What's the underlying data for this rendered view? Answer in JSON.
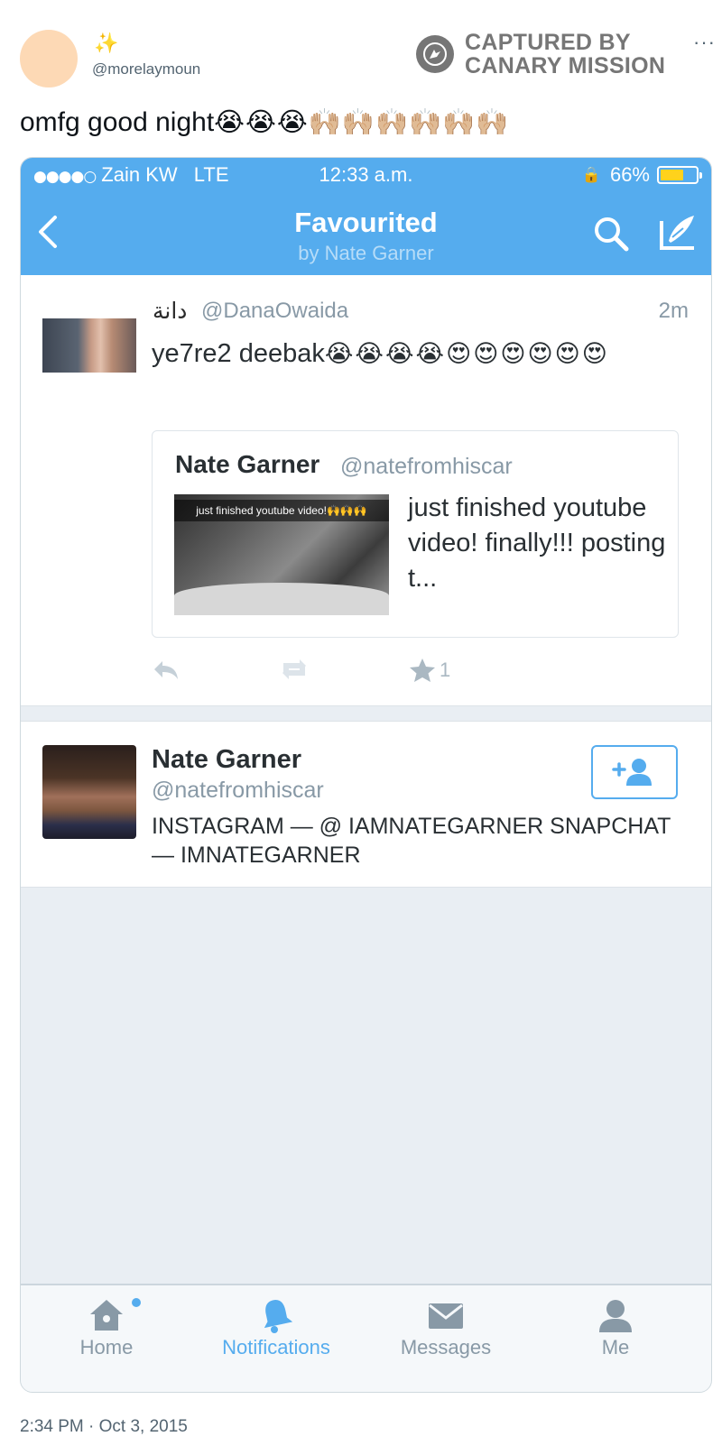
{
  "tweet": {
    "handle": "@morelaymoun",
    "sparkle_icon": "sparkles",
    "more_label": "···",
    "text": "omfg good night",
    "text_emoji": "😭😭😭🙌🏼🙌🏼🙌🏼🙌🏼🙌🏼🙌🏼",
    "timestamp": "2:34 PM · Oct 3, 2015"
  },
  "watermark": {
    "line1": "CAPTURED BY",
    "line2": "CANARY MISSION"
  },
  "phone": {
    "status": {
      "carrier_dots": "●●●●○",
      "carrier": "Zain KW",
      "network": "LTE",
      "time": "12:33 a.m.",
      "battery": "66%",
      "battery_level": 0.66
    },
    "nav": {
      "title": "Favourited",
      "subtitle": "by Nate Garner"
    },
    "fav_tweet": {
      "name": "دانة",
      "handle": "@DanaOwaida",
      "time": "2m",
      "text": "ye7re2 deebak",
      "emoji": "😭😭😭😭😍😍😍😍😍😍",
      "fav_count": "1",
      "quote": {
        "name": "Nate Garner",
        "handle": "@natefromhiscar",
        "image_caption": "just finished youtube video!🙌🙌🙌",
        "text": "just finished youtube video! finally!!! posting t..."
      }
    },
    "profile": {
      "name": "Nate Garner",
      "handle": "@natefromhiscar",
      "bio": "INSTAGRAM — @ IAMNATEGARNER SNAPCHAT — IMNATEGARNER"
    },
    "tabs": [
      {
        "label": "Home",
        "icon": "home-icon"
      },
      {
        "label": "Notifications",
        "icon": "bell-icon"
      },
      {
        "label": "Messages",
        "icon": "envelope-icon"
      },
      {
        "label": "Me",
        "icon": "person-icon"
      }
    ]
  },
  "colors": {
    "twitter_blue": "#55acee",
    "battery_yellow": "#ffd21c",
    "watermark_gray": "#767676",
    "muted_text": "#8899a6"
  }
}
